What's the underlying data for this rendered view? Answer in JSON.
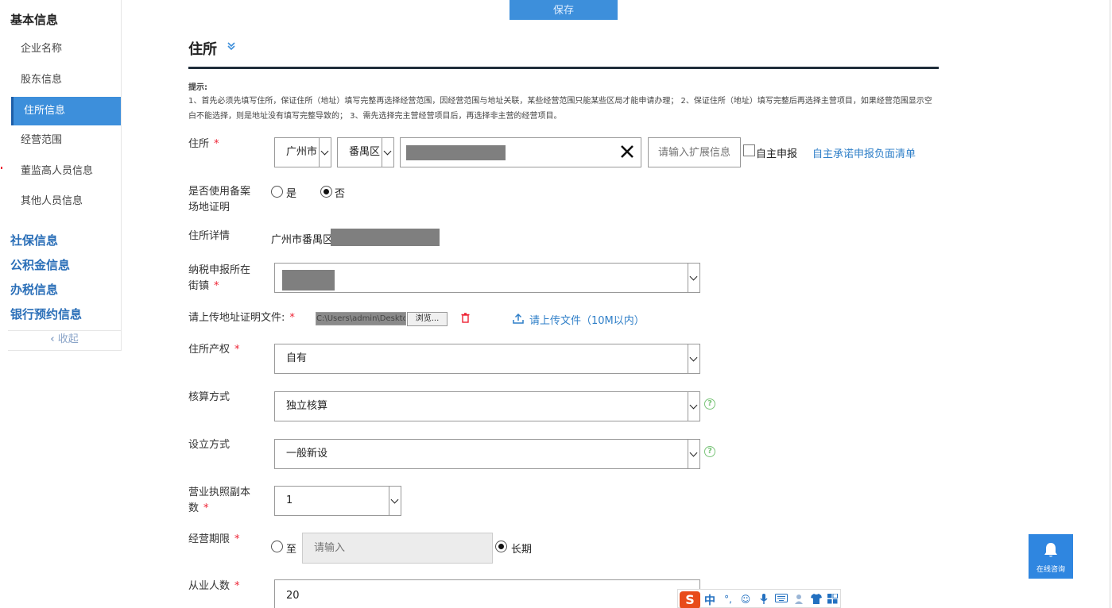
{
  "sidebar": {
    "title": "基本信息",
    "items": [
      "企业名称",
      "股东信息",
      "住所信息",
      "经营范围",
      "董监高人员信息",
      "其他人员信息"
    ],
    "active_index": 2,
    "sections": [
      "社保信息",
      "公积金信息",
      "办税信息",
      "银行预约信息"
    ],
    "collapse_label": "收起"
  },
  "top_button": {
    "label": "保存"
  },
  "section": {
    "title": "住所"
  },
  "hint": {
    "label": "提示:",
    "text": "1、首先必须先填写住所，保证住所（地址）填写完整再选择经营范围，因经营范围与地址关联，某些经营范围只能某些区局才能申请办理； 2、保证住所（地址）填写完整后再选择主营项目，如果经营范围显示空白不能选择，则是地址没有填写完整导致的； 3、需先选择完主营经营项目后，再选择非主营的经营项目。"
  },
  "form": {
    "address": {
      "label": "住所",
      "city": "广州市",
      "district": "番禺区",
      "extra_placeholder": "请输入扩展信息",
      "self_declare": "自主申报",
      "commit_link": "自主承诺申报负面清单"
    },
    "record_proof": {
      "label": "是否使用备案场地证明",
      "yes": "是",
      "no": "否",
      "selected": "否"
    },
    "address_detail": {
      "label": "住所详情",
      "value": "广州市番禺区"
    },
    "tax_street": {
      "label": "纳税申报所在街镇"
    },
    "upload": {
      "label": "请上传地址证明文件:",
      "browse": "浏览...",
      "file_text": "C:\\Users\\admin\\Desktop\\",
      "upload_link": "请上传文件（10M以内）"
    },
    "property": {
      "label": "住所产权",
      "value": "自有"
    },
    "accounting": {
      "label": "核算方式",
      "value": "独立核算"
    },
    "establish": {
      "label": "设立方式",
      "value": "一般新设"
    },
    "license_copies": {
      "label": "营业执照副本数",
      "value": "1"
    },
    "term": {
      "label": "经营期限",
      "to": "至",
      "placeholder": "请输入",
      "long": "长期",
      "selected": "长期"
    },
    "employees": {
      "label": "从业人数",
      "value": "20"
    }
  },
  "chat": {
    "label": "在线咨询"
  },
  "ime": {
    "logo": "S",
    "mode": "中"
  },
  "colors": {
    "accent": "#3d8fdb",
    "required": "#e23",
    "link": "#2f7fc8"
  }
}
